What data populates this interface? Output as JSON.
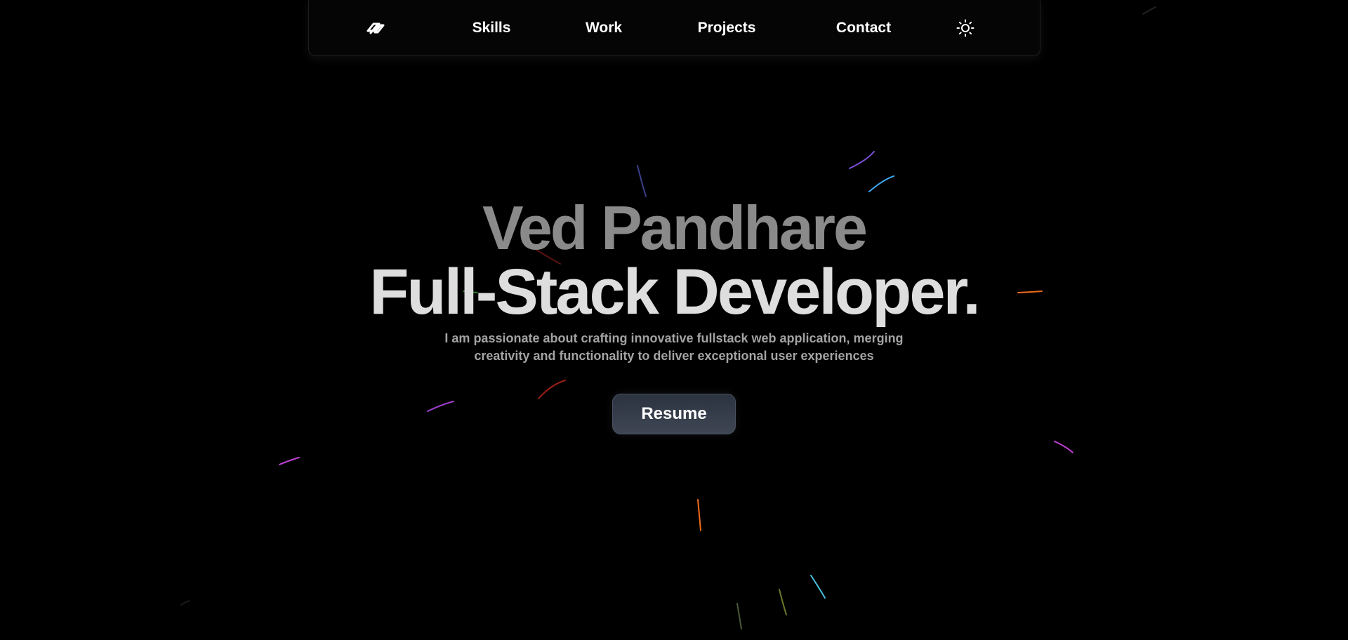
{
  "nav": {
    "logo_icon": "link-logo-icon",
    "items": [
      {
        "label": "Skills"
      },
      {
        "label": "Work"
      },
      {
        "label": "Projects"
      },
      {
        "label": "Contact"
      }
    ],
    "theme_icon": "sun-icon"
  },
  "hero": {
    "name": "Ved Pandhare",
    "role": "Full-Stack Developer.",
    "description": "I am passionate about crafting innovative fullstack web application, merging creativity and functionality to deliver exceptional user experiences",
    "resume_label": "Resume"
  },
  "colors": {
    "background": "#000000",
    "name_text": "#8a8a8a",
    "role_text": "#dedede",
    "description_text": "#a3a3a3",
    "button_bg": "#353c49",
    "streak_purple": "#7b4fd6",
    "streak_blue": "#3fa9f5",
    "streak_orange": "#f06a1a",
    "streak_magenta": "#c13fd8",
    "streak_red": "#9b1f14",
    "streak_cyan": "#49c2e0",
    "streak_olive": "#6d7a2a"
  }
}
